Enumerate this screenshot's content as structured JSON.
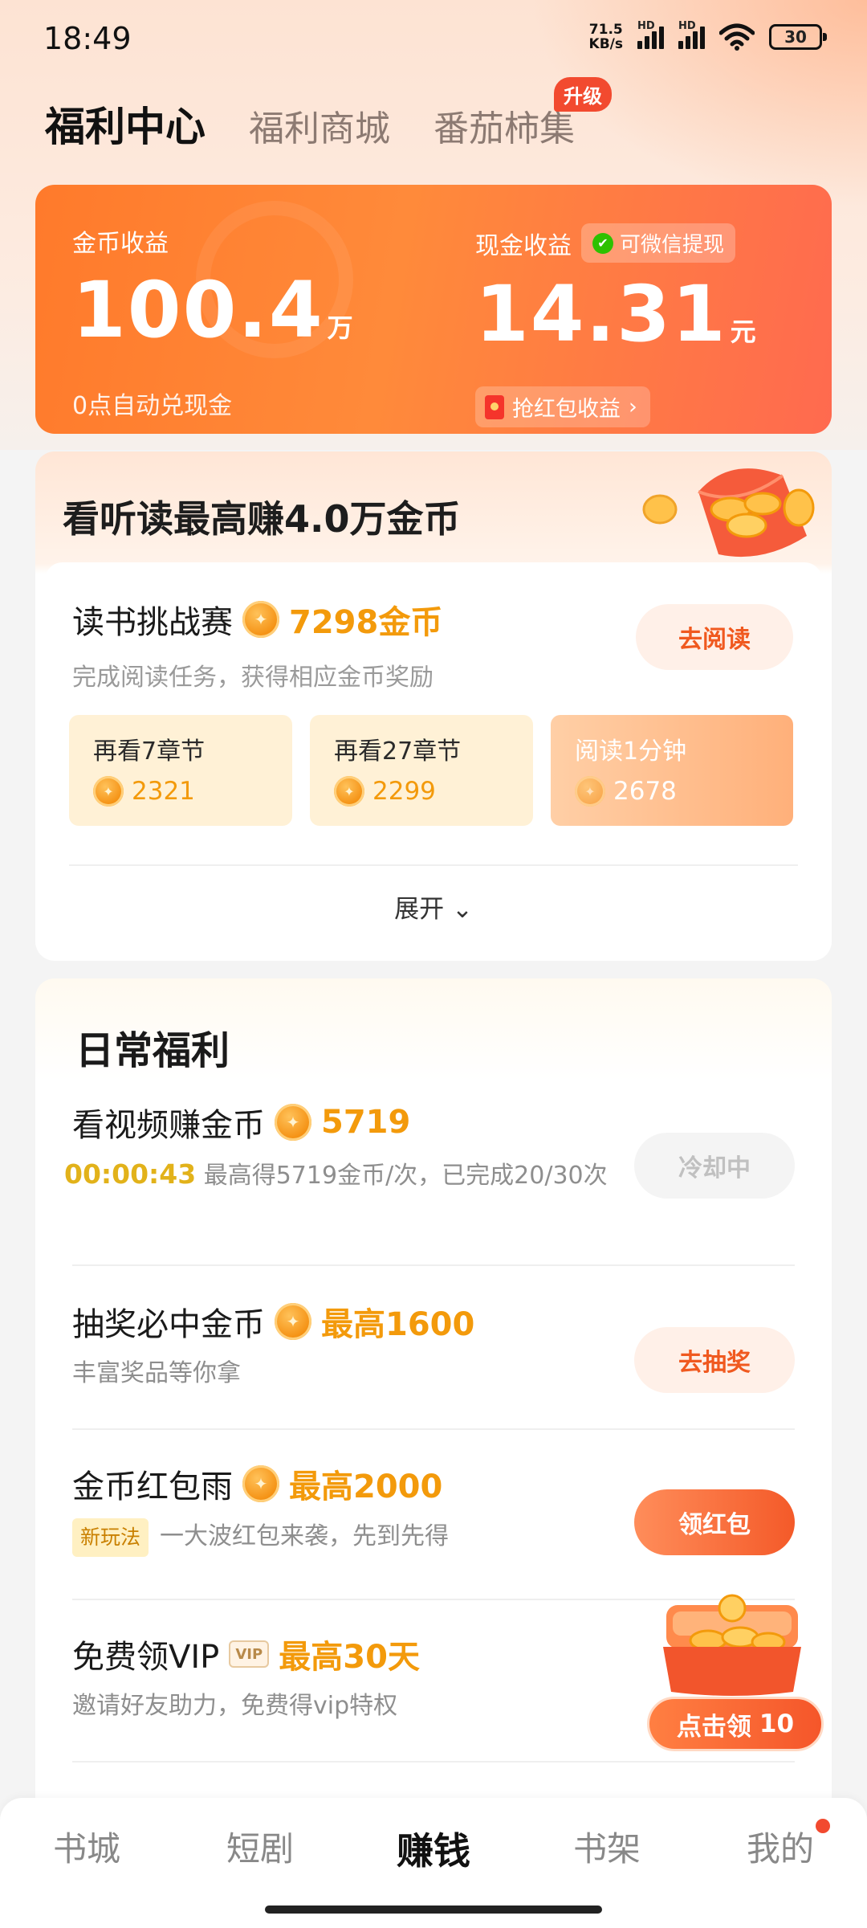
{
  "status_bar": {
    "time": "18:49",
    "net_speed_value": "71.5",
    "net_speed_unit": "KB/s",
    "hd_label": "HD",
    "battery": "30"
  },
  "top_tabs": [
    {
      "label": "福利中心",
      "active": true
    },
    {
      "label": "福利商城",
      "active": false
    },
    {
      "label": "番茄柿集",
      "active": false
    }
  ],
  "upgrade_badge": "升级",
  "earnings": {
    "coin_label": "金币收益",
    "coin_value": "100.4",
    "coin_unit": "万",
    "coin_sub": "0点自动兑现金",
    "cash_label": "现金收益",
    "wechat_chip": "可微信提现",
    "cash_value": "14.31",
    "cash_unit": "元",
    "redpack_chip": "抢红包收益",
    "redpack_arrow": "›"
  },
  "reading": {
    "title": "看听读最高赚4.0万金币",
    "challenge_title": "读书挑战赛",
    "challenge_amount": "7298金币",
    "challenge_sub": "完成阅读任务，获得相应金币奖励",
    "read_button": "去阅读",
    "chapters": [
      {
        "label": "再看7章节",
        "value": "2321"
      },
      {
        "label": "再看27章节",
        "value": "2299"
      },
      {
        "label": "阅读1分钟",
        "value": "2678"
      }
    ],
    "expand_label": "展开",
    "expand_arrow": "⌄"
  },
  "daily": {
    "title": "日常福利",
    "items": [
      {
        "title": "看视频赚金币",
        "amount": "5719",
        "timer": "00:00:43",
        "sub": "最高得5719金币/次，已完成20/30次",
        "button": "冷却中"
      },
      {
        "title": "抽奖必中金币",
        "amount": "最高1600",
        "sub": "丰富奖品等你拿",
        "button": "去抽奖"
      },
      {
        "title": "金币红包雨",
        "amount": "最高2000",
        "tag": "新玩法",
        "sub": "一大波红包来袭，先到先得",
        "button": "领红包"
      },
      {
        "title": "免费领VIP",
        "vip_tag": "VIP",
        "amount": "最高30天",
        "sub": "邀请好友助力，免费得vip特权"
      }
    ]
  },
  "floating_claim": {
    "label": "点击领",
    "count": "10"
  },
  "bottom_nav": [
    {
      "label": "书城",
      "active": false
    },
    {
      "label": "短剧",
      "active": false
    },
    {
      "label": "赚钱",
      "active": true
    },
    {
      "label": "书架",
      "active": false
    },
    {
      "label": "我的",
      "active": false,
      "dot": true
    }
  ],
  "colors": {
    "accent": "#ff7a2b",
    "coin_text": "#f39a0b",
    "timer": "#e2b21a"
  }
}
